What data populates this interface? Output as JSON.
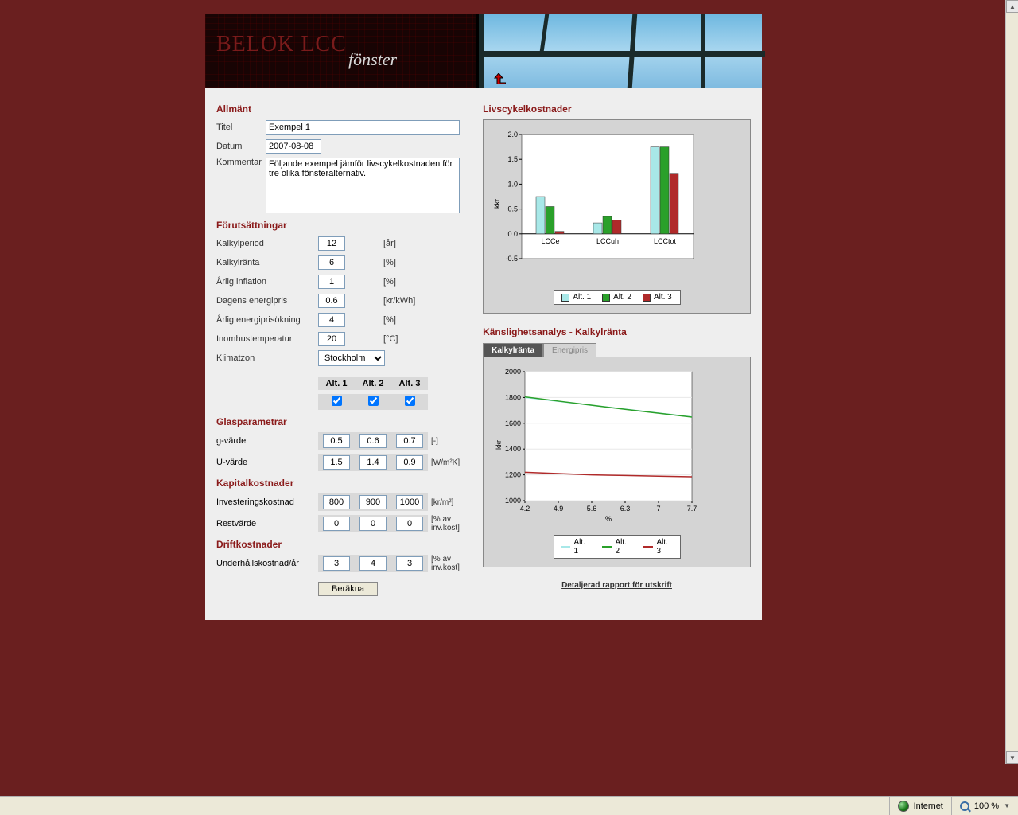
{
  "banner": {
    "title": "BELOK LCC",
    "subtitle": "fönster"
  },
  "sections": {
    "general": "Allmänt",
    "assumptions": "Förutsättningar",
    "glass": "Glasparametrar",
    "capital": "Kapitalkostnader",
    "operating": "Driftkostnader"
  },
  "general": {
    "title_label": "Titel",
    "title_value": "Exempel 1",
    "date_label": "Datum",
    "date_value": "2007-08-08",
    "comment_label": "Kommentar",
    "comment_value": "Följande exempel jämför livscykelkostnaden för tre olika fönsteralternativ."
  },
  "assumptions": {
    "kalkylperiod": {
      "label": "Kalkylperiod",
      "value": "12",
      "unit": "[år]"
    },
    "kalkylranta": {
      "label": "Kalkylränta",
      "value": "6",
      "unit": "[%]"
    },
    "inflation": {
      "label": "Årlig inflation",
      "value": "1",
      "unit": "[%]"
    },
    "energipris": {
      "label": "Dagens energipris",
      "value": "0.6",
      "unit": "[kr/kWh]"
    },
    "energiprisokning": {
      "label": "Årlig energiprisökning",
      "value": "4",
      "unit": "[%]"
    },
    "inomhustemp": {
      "label": "Inomhustemperatur",
      "value": "20",
      "unit": "[°C]"
    },
    "klimatzon": {
      "label": "Klimatzon",
      "value": "Stockholm"
    }
  },
  "alts": {
    "h1": "Alt. 1",
    "h2": "Alt. 2",
    "h3": "Alt. 3"
  },
  "glass": {
    "g": {
      "label": "g-värde",
      "a1": "0.5",
      "a2": "0.6",
      "a3": "0.7",
      "unit": "[-]"
    },
    "u": {
      "label": "U-värde",
      "a1": "1.5",
      "a2": "1.4",
      "a3": "0.9",
      "unit": "[W/m²K]"
    }
  },
  "capital": {
    "inv": {
      "label": "Investeringskostnad",
      "a1": "800",
      "a2": "900",
      "a3": "1000",
      "unit": "[kr/m²]"
    },
    "rest": {
      "label": "Restvärde",
      "a1": "0",
      "a2": "0",
      "a3": "0",
      "unit": "[% av inv.kost]"
    }
  },
  "operating": {
    "maint": {
      "label": "Underhållskostnad/år",
      "a1": "3",
      "a2": "4",
      "a3": "3",
      "unit": "[% av inv.kost]"
    }
  },
  "calc_button": "Beräkna",
  "right": {
    "title1": "Livscykelkostnader",
    "title2": "Känslighetsanalys - Kalkylränta",
    "tab1": "Kalkylränta",
    "tab2": "Energipris",
    "report_link": "Detaljerad rapport för utskrift"
  },
  "legend": {
    "a1": "Alt. 1",
    "a2": "Alt. 2",
    "a3": "Alt. 3"
  },
  "chart_data": [
    {
      "type": "bar",
      "ylabel": "kkr",
      "ylim": [
        -0.5,
        2.0
      ],
      "yticks": [
        -0.5,
        0.0,
        0.5,
        1.0,
        1.5,
        2.0
      ],
      "categories": [
        "LCCe",
        "LCCuh",
        "LCCtot"
      ],
      "series": [
        {
          "name": "Alt. 1",
          "color": "#a8e8e8",
          "values": [
            0.75,
            0.22,
            1.75
          ]
        },
        {
          "name": "Alt. 2",
          "color": "#2aa02a",
          "values": [
            0.55,
            0.35,
            1.75
          ]
        },
        {
          "name": "Alt. 3",
          "color": "#b02a2a",
          "values": [
            0.05,
            0.28,
            1.22
          ]
        }
      ]
    },
    {
      "type": "line",
      "xlabel": "%",
      "ylabel": "kkr",
      "xlim": [
        4.2,
        7.7
      ],
      "xticks": [
        4.2,
        4.9,
        5.6,
        6.3,
        7,
        7.7
      ],
      "ylim": [
        1000,
        2000
      ],
      "yticks": [
        1000,
        1200,
        1400,
        1600,
        1800,
        2000
      ],
      "series": [
        {
          "name": "Alt. 1",
          "color": "#a8e8e8",
          "x": [
            4.2,
            4.9,
            5.6,
            6.3,
            7,
            7.7
          ],
          "y": [
            1800,
            1770,
            1740,
            1710,
            1680,
            1650
          ]
        },
        {
          "name": "Alt. 2",
          "color": "#2aa02a",
          "x": [
            4.2,
            4.9,
            5.6,
            6.3,
            7,
            7.7
          ],
          "y": [
            1805,
            1772,
            1740,
            1708,
            1678,
            1648
          ]
        },
        {
          "name": "Alt. 3",
          "color": "#b02a2a",
          "x": [
            4.2,
            4.9,
            5.6,
            6.3,
            7,
            7.7
          ],
          "y": [
            1220,
            1210,
            1200,
            1195,
            1190,
            1185
          ]
        }
      ]
    }
  ],
  "status": {
    "zone": "Internet",
    "zoom": "100 %"
  }
}
